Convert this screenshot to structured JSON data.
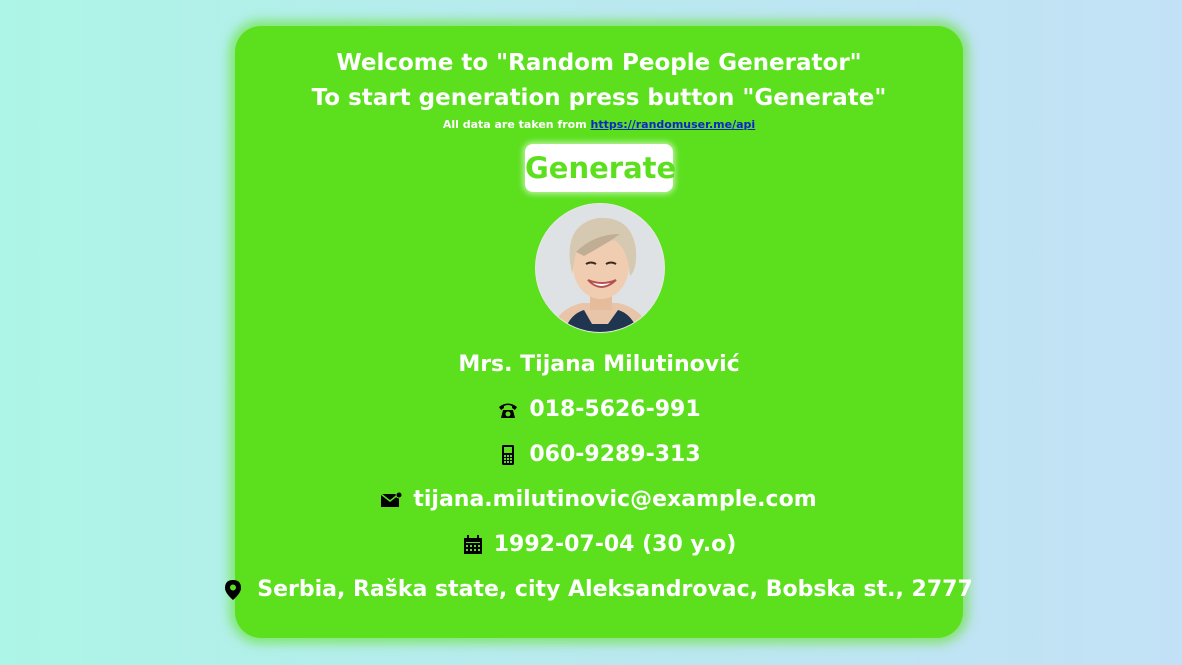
{
  "header": {
    "welcome": "Welcome to \"Random People Generator\"",
    "instruction": "To start generation press button \"Generate\"",
    "source_prefix": "All data are taken from ",
    "source_link": "https://randomuser.me/api"
  },
  "generate_button": {
    "label": "Generate"
  },
  "person": {
    "name": "Mrs. Tijana Milutinović",
    "phone": "018-5626-991",
    "cell": "060-9289-313",
    "email": "tijana.milutinovic@example.com",
    "dob": "1992-07-04 (30 y.o)",
    "location": "Serbia, Raška state, city Aleksandrovac, Bobska st., 2777"
  },
  "colors": {
    "card": "#5ce01e",
    "link": "#0b24c9",
    "icon": "#000000"
  },
  "icons": [
    "phone-icon",
    "mobile-icon",
    "email-icon",
    "calendar-icon",
    "location-pin-icon"
  ]
}
